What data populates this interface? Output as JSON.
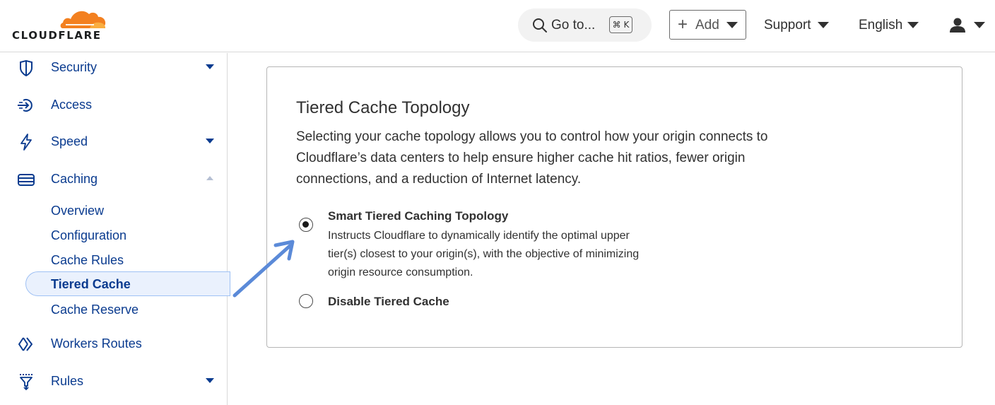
{
  "header": {
    "logo_text": "CLOUDFLARE",
    "goto_label": "Go to...",
    "goto_shortcut": "⌘ K",
    "add_label": "Add",
    "support_label": "Support",
    "language_label": "English",
    "brand_color": "#f38020"
  },
  "sidebar": {
    "items": [
      {
        "label": "Security",
        "icon": "shield-icon"
      },
      {
        "label": "Access",
        "icon": "access-icon"
      },
      {
        "label": "Speed",
        "icon": "lightning-icon"
      },
      {
        "label": "Caching",
        "icon": "caching-icon"
      },
      {
        "label": "Workers Routes",
        "icon": "workers-icon"
      },
      {
        "label": "Rules",
        "icon": "rules-icon"
      }
    ],
    "caching_sub": [
      "Overview",
      "Configuration",
      "Cache Rules",
      "Tiered Cache",
      "Cache Reserve"
    ],
    "active_sub": "Tiered Cache",
    "link_color": "#0a3b8f"
  },
  "card": {
    "title": "Tiered Cache Topology",
    "description": "Selecting your cache topology allows you to control how your origin connects to Cloudflare’s data centers to help ensure higher cache hit ratios, fewer origin connections, and a reduction of Internet latency.",
    "options": [
      {
        "title": "Smart Tiered Caching Topology",
        "description": "Instructs Cloudflare to dynamically identify the optimal upper tier(s) closest to your origin(s), with the objective of minimizing origin resource consumption.",
        "selected": true
      },
      {
        "title": "Disable Tiered Cache",
        "selected": false
      }
    ]
  },
  "annotation": {
    "arrow_color": "#5b8ad8"
  }
}
